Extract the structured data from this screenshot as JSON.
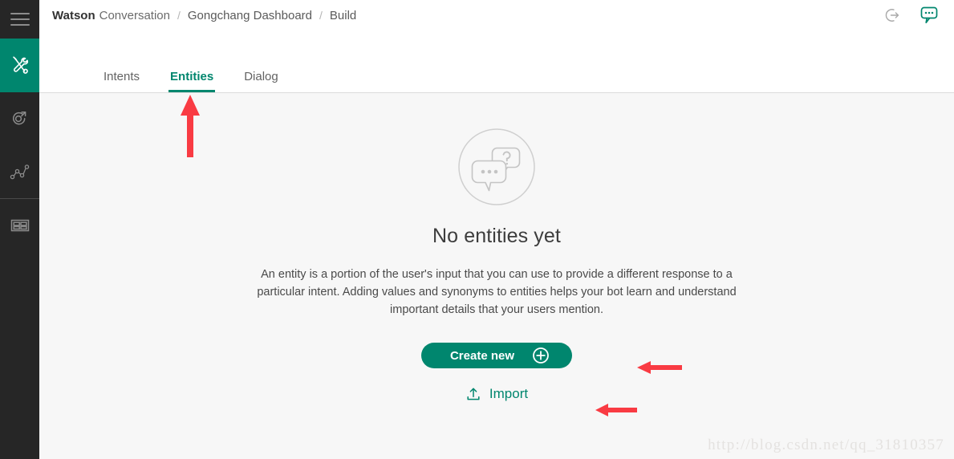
{
  "sidebar": {
    "items": [
      {
        "name": "menu-toggle",
        "icon": "hamburger-icon",
        "active": false
      },
      {
        "name": "build-tools",
        "icon": "tools-icon",
        "active": true
      },
      {
        "name": "deploy",
        "icon": "deploy-icon",
        "active": false
      },
      {
        "name": "improve-analytics",
        "icon": "analytics-icon",
        "active": false
      },
      {
        "name": "workspaces",
        "icon": "grid-icon",
        "active": false
      }
    ]
  },
  "header": {
    "product_strong": "Watson",
    "product_light": "Conversation",
    "separator": "/",
    "crumbs": [
      "Gongchang Dashboard",
      "Build"
    ],
    "actions": [
      {
        "name": "logout",
        "icon": "logout-icon"
      },
      {
        "name": "chat",
        "icon": "chat-bubble-icon"
      }
    ]
  },
  "tabs": [
    {
      "label": "Intents",
      "active": false
    },
    {
      "label": "Entities",
      "active": true
    },
    {
      "label": "Dialog",
      "active": false
    }
  ],
  "empty_state": {
    "illustration": "chat-bubbles-question-icon",
    "title": "No entities yet",
    "description": "An entity is a portion of the user's input that you can use to provide a different response to a particular intent. Adding values and synonyms to entities helps your bot learn and understand important details that your users mention.",
    "primary_button": {
      "label": "Create new",
      "icon": "plus-circle-icon"
    },
    "secondary_button": {
      "label": "Import",
      "icon": "upload-icon"
    }
  },
  "annotations": [
    {
      "name": "arrow-to-entities-tab",
      "direction": "up"
    },
    {
      "name": "arrow-to-create-new",
      "direction": "left"
    },
    {
      "name": "arrow-to-import",
      "direction": "left"
    }
  ],
  "watermark": "http://blog.csdn.net/qq_31810357",
  "colors": {
    "accent": "#00866e",
    "rail_bg": "#262626",
    "body_bg": "#f7f7f7",
    "annotation_red": "#f93b43"
  }
}
